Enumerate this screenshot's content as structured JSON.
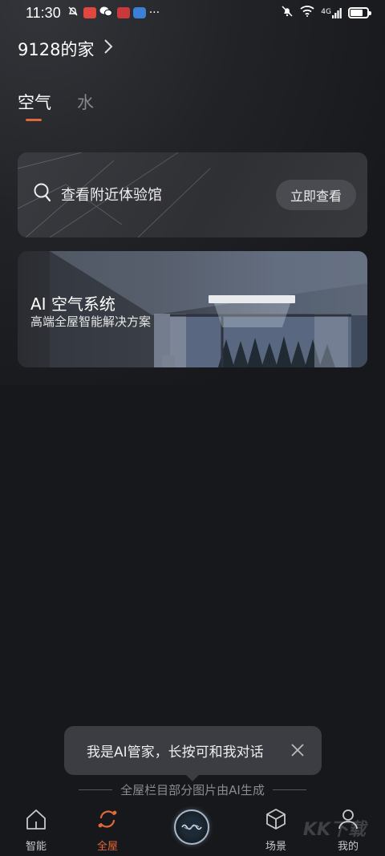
{
  "status_bar": {
    "time": "11:30",
    "network": "4G",
    "battery_level": 0.75,
    "more": "···"
  },
  "header": {
    "home_name": "9128的家"
  },
  "tabs": [
    {
      "label": "空气",
      "active": true
    },
    {
      "label": "水",
      "active": false
    }
  ],
  "search_card": {
    "label": "查看附近体验馆",
    "button": "立即查看"
  },
  "ai_card": {
    "title": "AI 空气系统",
    "subtitle": "高端全屋智能解决方案"
  },
  "toast": {
    "text": "我是AI管家，长按可和我对话"
  },
  "ai_note": "全屋栏目部分图片由AI生成",
  "bottom_nav": [
    {
      "label": "智能",
      "icon": "house-icon",
      "active": false
    },
    {
      "label": "全屋",
      "icon": "sync-icon",
      "active": true
    },
    {
      "label": "",
      "icon": "voice-assistant-icon",
      "active": false
    },
    {
      "label": "场景",
      "icon": "cube-icon",
      "active": false
    },
    {
      "label": "我的",
      "icon": "person-icon",
      "active": false
    }
  ],
  "watermark": "KK下载",
  "colors": {
    "accent": "#e2673a",
    "background": "#17181b",
    "card": "#35363b"
  }
}
